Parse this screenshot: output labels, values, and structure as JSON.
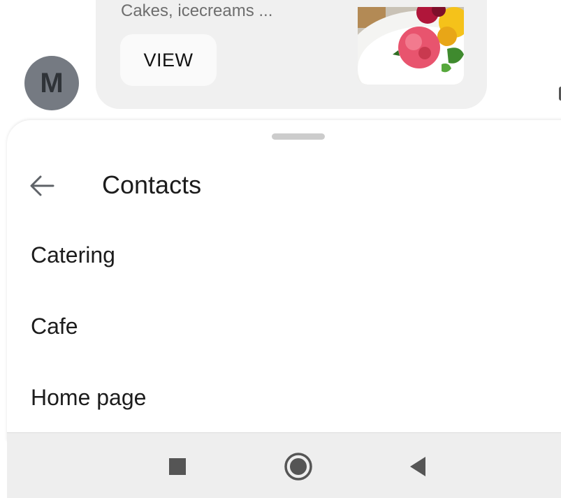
{
  "chat": {
    "avatar_letter": "M",
    "card": {
      "subtitle": "Cakes, icecreams ...",
      "view_button": "VIEW"
    }
  },
  "sheet": {
    "title": "Contacts",
    "items": [
      {
        "label": "Catering"
      },
      {
        "label": "Cafe"
      },
      {
        "label": "Home page"
      }
    ]
  },
  "icons": {
    "back": "arrow-left-icon",
    "nav_recents": "square-icon",
    "nav_home": "circle-icon",
    "nav_back": "triangle-icon",
    "card_image": "dessert-image"
  },
  "colors": {
    "avatar_bg": "#757a82",
    "card_bg": "#f0f0f0",
    "navbar_bg": "#eeeeee",
    "nav_icon": "#555555"
  }
}
